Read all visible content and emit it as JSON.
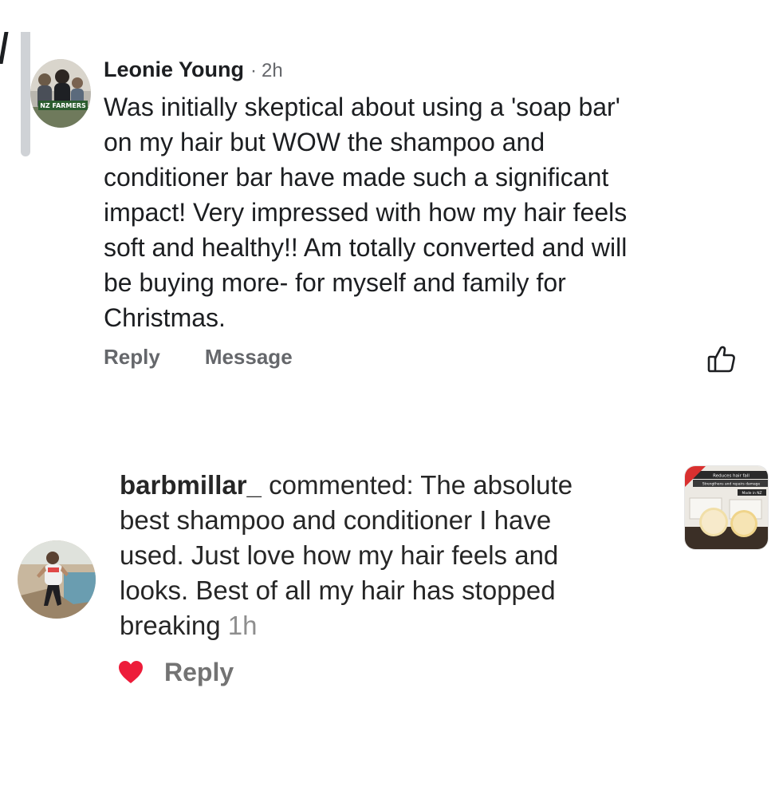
{
  "comment_1": {
    "author": "Leonie Young",
    "separator": "·",
    "time": "2h",
    "body": "Was initially skeptical about using a 'soap bar'\non my hair but WOW the shampoo and\nconditioner bar have made such a significant\nimpact! Very impressed with how my hair feels\nsoft and healthy!! Am totally converted and will\nbe buying more- for myself and family for\nChristmas.",
    "actions": {
      "reply": "Reply",
      "message": "Message"
    },
    "avatar_badge_text": "NZ FARMERS",
    "icons": {
      "like": "thumbs-up-icon"
    }
  },
  "comment_2": {
    "username": "barbmillar_",
    "body": " commented: The absolute\nbest shampoo and conditioner I have\nused. Just love how my hair feels and\nlooks. Best of all my hair has stopped\nbreaking ",
    "time": "1h",
    "reply": "Reply",
    "icons": {
      "heart": "heart-icon"
    },
    "colors": {
      "heart": "#ed1c3a"
    },
    "thumbnail_text": {
      "line1": "Reduces hair fall",
      "line2": "Strengthens and repairs damage",
      "line3": "Made in NZ"
    }
  },
  "colors": {
    "primary_text": "#1c1e21",
    "secondary_text": "#65676b",
    "ig_secondary": "#8e8e8e"
  }
}
